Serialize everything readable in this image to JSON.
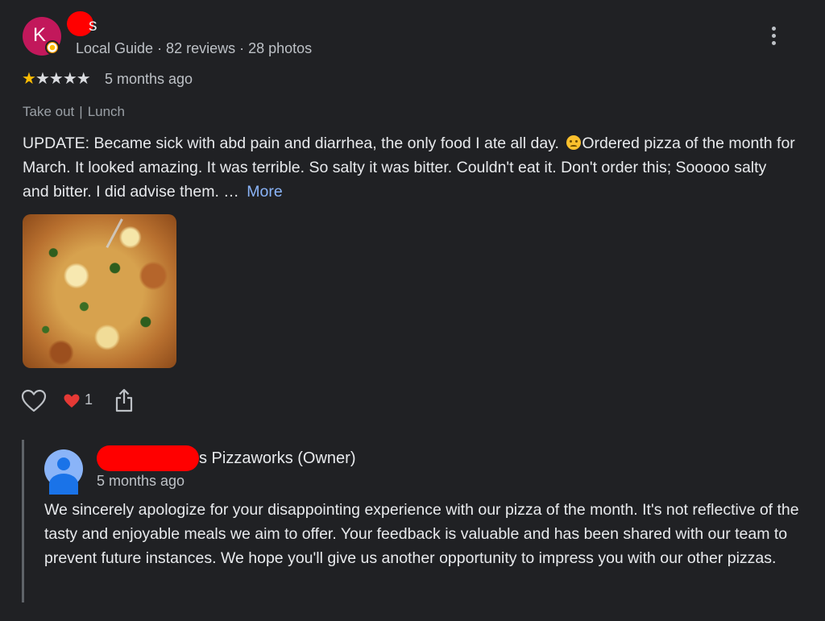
{
  "reviewer": {
    "avatar_initial": "K",
    "name_visible": "s",
    "meta": "Local Guide · 82 reviews · 28 photos",
    "rating": 1,
    "rating_max": 5,
    "time": "5 months ago",
    "tags": [
      "Take out",
      "Lunch"
    ]
  },
  "review": {
    "text_before_emoji": "UPDATE: Became sick with abd pain and diarrhea, the only food I ate all day. ",
    "text_after_emoji": "Ordered pizza of the month for March. It looked amazing. It was terrible. So salty it was bitter. Couldn't eat it. Don't order this; Sooooo salty and bitter. I did advise them. … ",
    "more_label": "More"
  },
  "actions": {
    "reaction_count": "1"
  },
  "reply": {
    "owner_name_visible": "s Pizzaworks (Owner)",
    "time": "5 months ago",
    "text": "We sincerely apologize for your disappointing experience with our pizza of the month. It's not reflective of the tasty and enjoyable meals we aim to offer. Your feedback is valuable and has been shared with our team to prevent future instances. We hope you'll give us another opportunity to impress you with our other pizzas."
  },
  "icons": {
    "more_options": "more-vert-icon",
    "like": "heart-outline-icon",
    "reaction": "red-heart-emoji-icon",
    "share": "share-icon",
    "guide_badge": "local-guide-badge-icon",
    "emoji": "angry-face-emoji-icon"
  },
  "colors": {
    "background": "#202124",
    "avatar": "#c2185b",
    "star": "#fbbc04",
    "link": "#8ab4f8",
    "redaction": "#ff0000"
  }
}
